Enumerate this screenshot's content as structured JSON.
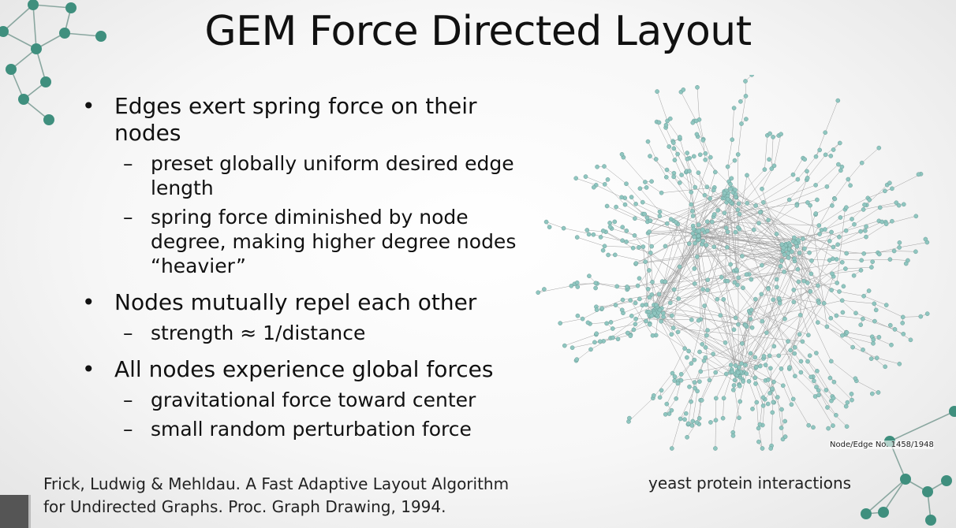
{
  "title": "GEM Force Directed Layout",
  "bullets": [
    {
      "text": "Edges exert spring force on their nodes",
      "sub": [
        "preset globally uniform desired edge length",
        "spring force diminished by node degree, making higher degree nodes “heavier”"
      ]
    },
    {
      "text": "Nodes mutually repel each other",
      "sub": [
        "strength ≈ 1/distance"
      ]
    },
    {
      "text": "All nodes experience global forces",
      "sub": [
        "gravitational force toward center",
        "small random perturbation force"
      ]
    }
  ],
  "bullet_marker": "•",
  "sub_marker": "–",
  "figure": {
    "node_edge_label": "Node/Edge No. 1458/1948",
    "caption": "yeast protein interactions",
    "node_color": "#8fc6c0",
    "edge_color": "#8a8a8a"
  },
  "citation": {
    "line1": "Frick, Ludwig & Mehldau. A Fast Adaptive Layout Algorithm",
    "line2": "for Undirected Graphs. Proc. Graph Drawing, 1994."
  },
  "decor": {
    "node_color": "#3f8f7e",
    "line_color": "#8aa7a0"
  }
}
